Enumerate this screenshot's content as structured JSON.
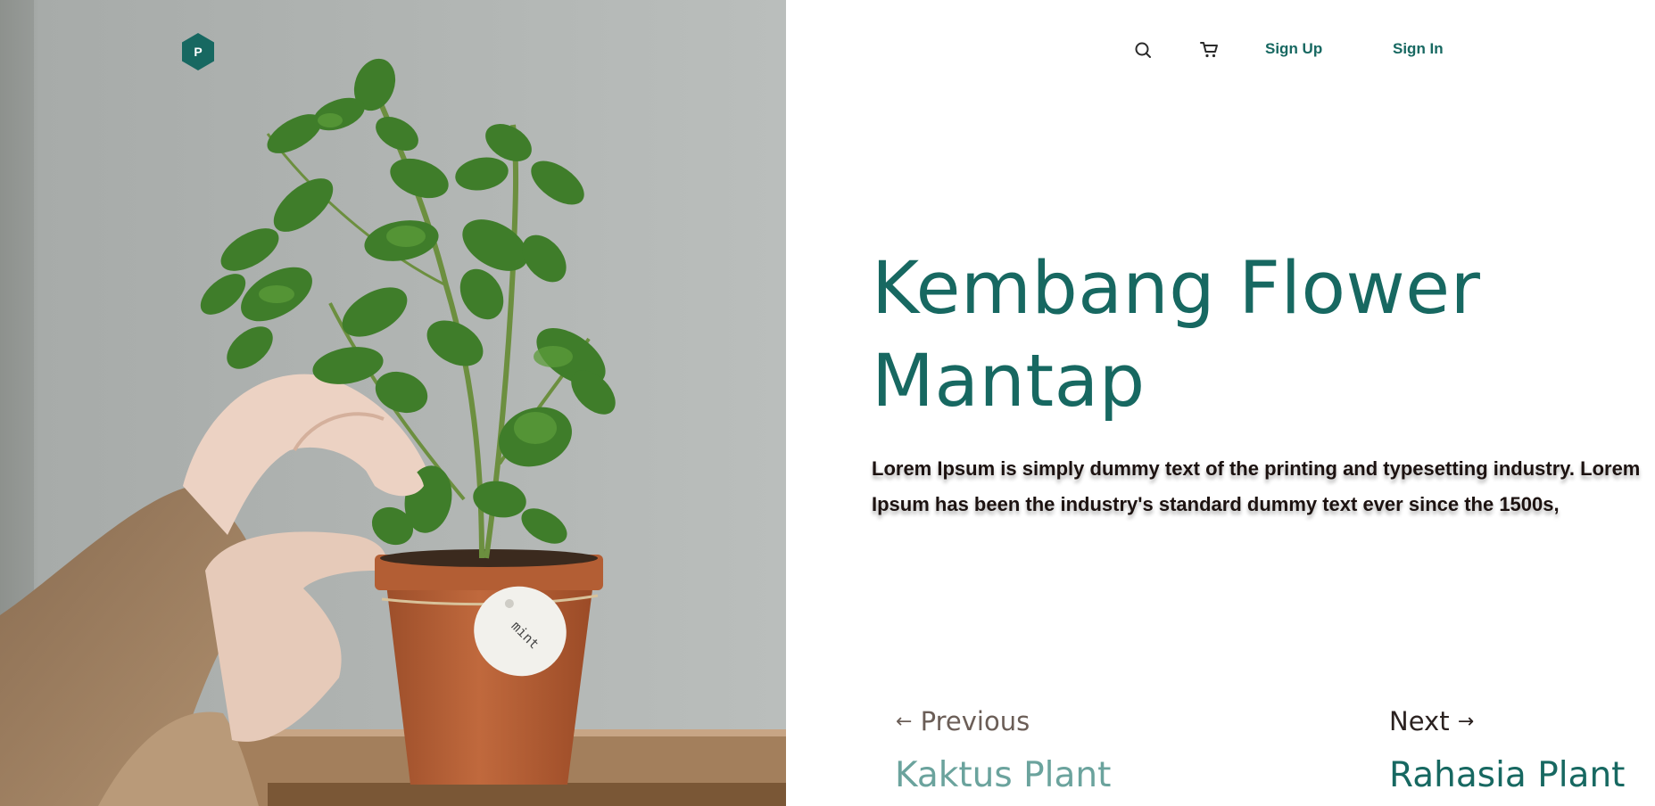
{
  "brand": {
    "logo_letter": "P",
    "accent_color": "#176861"
  },
  "hero_image": {
    "subject": "potted mint plant",
    "pot_tag_text": "mint"
  },
  "nav": {
    "search_icon": "search-icon",
    "cart_icon": "cart-icon",
    "signup_label": "Sign Up",
    "signin_label": "Sign In"
  },
  "hero": {
    "title_line1": "Kembang Flower",
    "title_line2": "Mantap",
    "description": "Lorem Ipsum is simply dummy text of the printing and typesetting industry. Lorem Ipsum has been the industry's standard dummy text ever since the 1500s,"
  },
  "pager": {
    "previous_label": "Previous",
    "previous_arrow": "←",
    "previous_title": "Kaktus Plant",
    "next_label": "Next",
    "next_arrow": "→",
    "next_title": "Rahasia Plant"
  }
}
